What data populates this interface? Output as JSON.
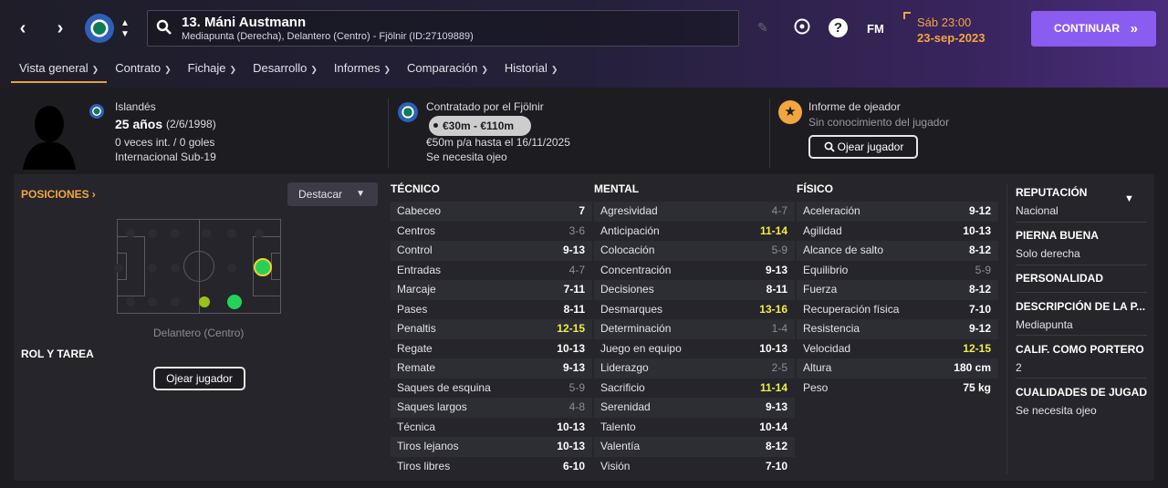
{
  "header": {
    "player_name": "13. Máni Austmann",
    "player_sub": "Mediapunta (Derecha), Delantero (Centro) - Fjölnir (ID:27109889)",
    "fm_label": "FM",
    "help_label": "?",
    "date_time": "Sáb 23:00",
    "date": "23-sep-2023",
    "continue_label": "CONTINUAR",
    "continue_chevron": "»",
    "accent_color": "#f2a640",
    "button_color": "#8a5cf0"
  },
  "tabs": [
    {
      "label": "Vista general"
    },
    {
      "label": "Contrato"
    },
    {
      "label": "Fichaje"
    },
    {
      "label": "Desarrollo"
    },
    {
      "label": "Informes"
    },
    {
      "label": "Comparación"
    },
    {
      "label": "Historial"
    }
  ],
  "profile": {
    "nationality": "Islandés",
    "age": "25 años",
    "dob": "(2/6/1998)",
    "caps": "0 veces int. / 0 goles",
    "international": "Internacional Sub-19"
  },
  "contract": {
    "title": "Contratado por el Fjölnir",
    "value_range": "€30m - €110m",
    "wage": "€50m p/a hasta el 16/11/2025",
    "scout_needed": "Se necesita ojeo"
  },
  "scout_report": {
    "title": "Informe de ojeador",
    "subtitle": "Sin conocimiento del jugador",
    "button_label": "Ojear jugador"
  },
  "positions": {
    "title": "POSICIONES",
    "title_chevron": "›",
    "highlight_label": "Destacar",
    "position_label": "Delantero (Centro)",
    "role_title": "ROL Y TAREA",
    "scout_button": "Ojear jugador"
  },
  "tecnico": {
    "title": "TÉCNICO",
    "rows": [
      {
        "name": "Cabeceo",
        "value": "7",
        "style": "normal"
      },
      {
        "name": "Centros",
        "value": "3-6",
        "style": "dim"
      },
      {
        "name": "Control",
        "value": "9-13",
        "style": "normal"
      },
      {
        "name": "Entradas",
        "value": "4-7",
        "style": "dim"
      },
      {
        "name": "Marcaje",
        "value": "7-11",
        "style": "normal"
      },
      {
        "name": "Pases",
        "value": "8-11",
        "style": "normal"
      },
      {
        "name": "Penaltis",
        "value": "12-15",
        "style": "hi"
      },
      {
        "name": "Regate",
        "value": "10-13",
        "style": "normal"
      },
      {
        "name": "Remate",
        "value": "9-13",
        "style": "normal"
      },
      {
        "name": "Saques de esquina",
        "value": "5-9",
        "style": "dim"
      },
      {
        "name": "Saques largos",
        "value": "4-8",
        "style": "dim"
      },
      {
        "name": "Técnica",
        "value": "10-13",
        "style": "normal"
      },
      {
        "name": "Tiros lejanos",
        "value": "10-13",
        "style": "normal"
      },
      {
        "name": "Tiros libres",
        "value": "6-10",
        "style": "normal"
      }
    ]
  },
  "mental": {
    "title": "MENTAL",
    "rows": [
      {
        "name": "Agresividad",
        "value": "4-7",
        "style": "dim"
      },
      {
        "name": "Anticipación",
        "value": "11-14",
        "style": "hi"
      },
      {
        "name": "Colocación",
        "value": "5-9",
        "style": "dim"
      },
      {
        "name": "Concentración",
        "value": "9-13",
        "style": "normal"
      },
      {
        "name": "Decisiones",
        "value": "8-11",
        "style": "normal"
      },
      {
        "name": "Desmarques",
        "value": "13-16",
        "style": "hi"
      },
      {
        "name": "Determinación",
        "value": "1-4",
        "style": "dim"
      },
      {
        "name": "Juego en equipo",
        "value": "10-13",
        "style": "normal"
      },
      {
        "name": "Liderazgo",
        "value": "2-5",
        "style": "dim"
      },
      {
        "name": "Sacrificio",
        "value": "11-14",
        "style": "hi"
      },
      {
        "name": "Serenidad",
        "value": "9-13",
        "style": "normal"
      },
      {
        "name": "Talento",
        "value": "10-14",
        "style": "normal"
      },
      {
        "name": "Valentía",
        "value": "8-12",
        "style": "normal"
      },
      {
        "name": "Visión",
        "value": "7-10",
        "style": "normal"
      }
    ]
  },
  "fisico": {
    "title": "FÍSICO",
    "rows": [
      {
        "name": "Aceleración",
        "value": "9-12",
        "style": "normal"
      },
      {
        "name": "Agilidad",
        "value": "10-13",
        "style": "normal"
      },
      {
        "name": "Alcance de salto",
        "value": "8-12",
        "style": "normal"
      },
      {
        "name": "Equilibrio",
        "value": "5-9",
        "style": "dim"
      },
      {
        "name": "Fuerza",
        "value": "8-12",
        "style": "normal"
      },
      {
        "name": "Recuperación física",
        "value": "7-10",
        "style": "normal"
      },
      {
        "name": "Resistencia",
        "value": "9-12",
        "style": "normal"
      },
      {
        "name": "Velocidad",
        "value": "12-15",
        "style": "hi"
      },
      {
        "name": "Altura",
        "value": "180 cm",
        "style": "normal"
      },
      {
        "name": "Peso",
        "value": "75 kg",
        "style": "normal"
      }
    ]
  },
  "sidebar": {
    "reputation_title": "REPUTACIÓN",
    "reputation_value": "Nacional",
    "foot_title": "PIERNA BUENA",
    "foot_value": "Solo derecha",
    "personality_title": "PERSONALIDAD",
    "description_title": "DESCRIPCIÓN DE LA P...",
    "description_value": "Mediapunta",
    "gk_title": "CALIF. COMO PORTERO",
    "gk_value": "2",
    "qualities_title": "CUALIDADES DE JUGADO",
    "qualities_value": "Se necesita ojeo"
  }
}
